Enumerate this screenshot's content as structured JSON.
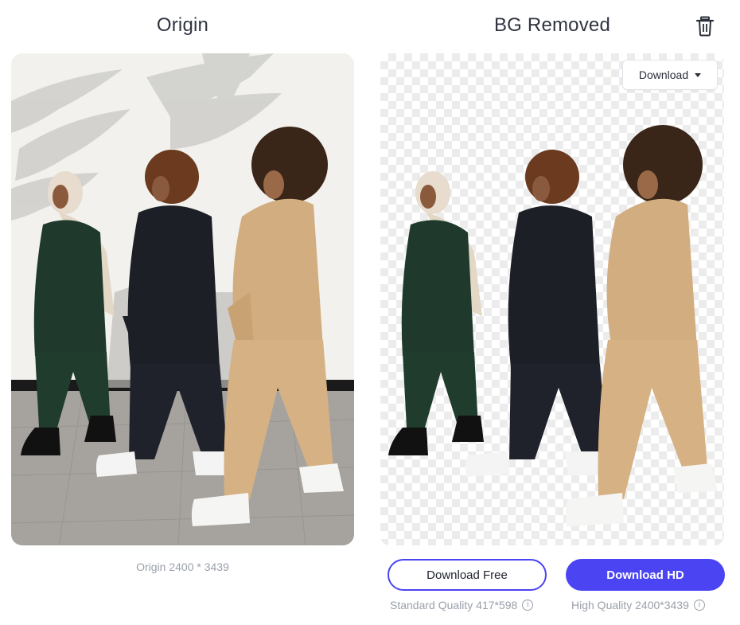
{
  "panels": {
    "origin_title": "Origin",
    "removed_title": "BG Removed"
  },
  "origin": {
    "caption": "Origin 2400 * 3439"
  },
  "removed": {
    "download_dropdown_label": "Download"
  },
  "actions": {
    "download_free_label": "Download Free",
    "download_hd_label": "Download HD",
    "standard_quality": "Standard Quality 417*598",
    "high_quality": "High Quality 2400*3439",
    "info_glyph": "i"
  },
  "icons": {
    "delete": "trash-icon",
    "dropdown": "caret-down-icon",
    "info": "info-icon"
  },
  "colors": {
    "accent": "#4a44f2",
    "muted_text": "#9aa0aa",
    "title_text": "#2f3440"
  }
}
